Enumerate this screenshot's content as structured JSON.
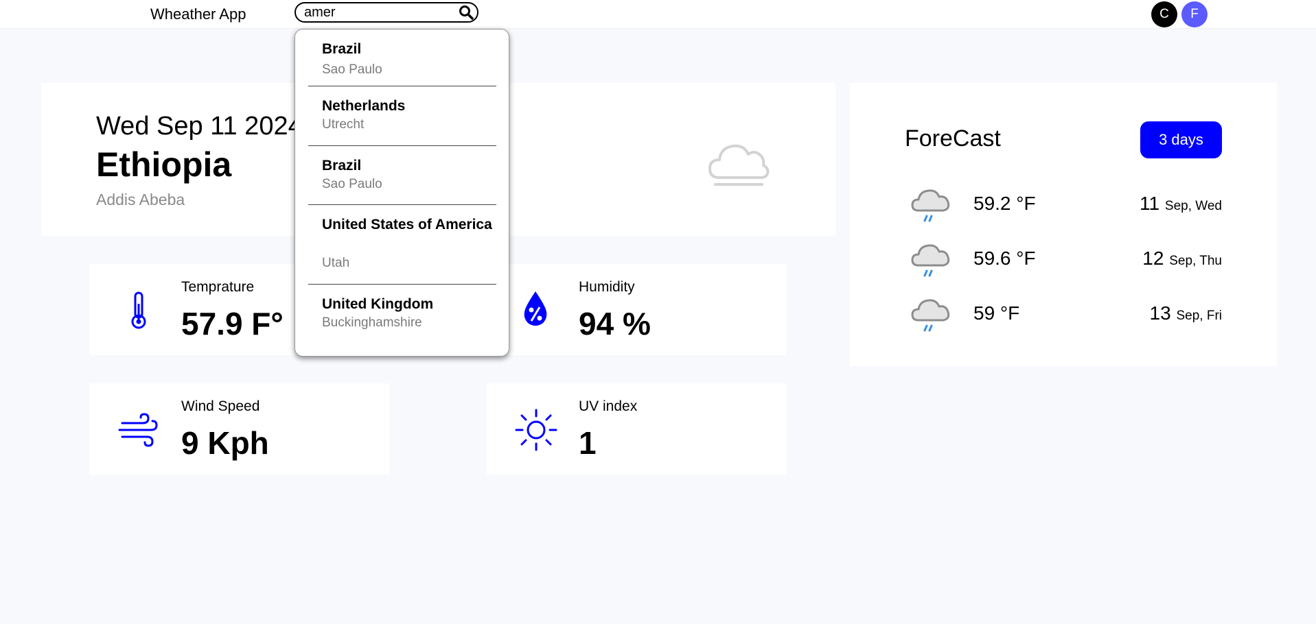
{
  "app": {
    "title": "Wheather App"
  },
  "search": {
    "value": "amer",
    "button_icon": "search-icon"
  },
  "users": [
    {
      "initial": "C",
      "color": "#000000"
    },
    {
      "initial": "F",
      "color": "#5b5bff"
    }
  ],
  "current": {
    "date": "Wed Sep 11 2024",
    "country": "Ethiopia",
    "city": "Addis Abeba",
    "icon": "fog-cloud-icon"
  },
  "stats": {
    "temperature": {
      "label": "Temprature",
      "value": "57.9 F°",
      "icon": "thermometer-icon"
    },
    "humidity": {
      "label": "Humidity",
      "value": "94 %",
      "icon": "humidity-drop-icon"
    },
    "wind": {
      "label": "Wind Speed",
      "value": "9 Kph",
      "icon": "wind-icon"
    },
    "uv": {
      "label": "UV index",
      "value": "1",
      "icon": "sun-icon"
    }
  },
  "forecast": {
    "title": "ForeCast",
    "range_button": "3 days",
    "days": [
      {
        "temp": "59.2 °F",
        "day": "11",
        "label": "Sep, Wed",
        "icon": "rain-cloud-icon"
      },
      {
        "temp": "59.6 °F",
        "day": "12",
        "label": "Sep, Thu",
        "icon": "rain-cloud-icon"
      },
      {
        "temp": "59 °F",
        "day": "13",
        "label": "Sep, Fri",
        "icon": "rain-cloud-icon"
      }
    ]
  },
  "suggestions": [
    {
      "country": "Brazil",
      "region": "Sao Paulo"
    },
    {
      "country": "Netherlands",
      "region": "Utrecht"
    },
    {
      "country": "Brazil",
      "region": "Sao Paulo"
    },
    {
      "country": "United States of America",
      "region": "Utah"
    },
    {
      "country": "United Kingdom",
      "region": "Buckinghamshire"
    }
  ],
  "colors": {
    "accent": "#0000ff",
    "background": "#f7f9fc",
    "muted_text": "#8a8a8a"
  }
}
